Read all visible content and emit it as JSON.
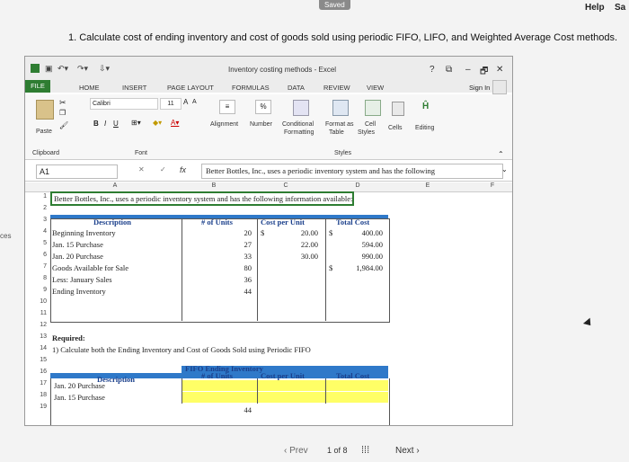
{
  "topbar": {
    "saved": "Saved",
    "help": "Help",
    "cut_right": "Sa",
    "cut_left": "ces"
  },
  "question": "1. Calculate cost of ending inventory and cost of goods sold using periodic FIFO, LIFO, and Weighted Average Cost methods.",
  "excel": {
    "title": "Inventory costing methods - Excel",
    "window_buttons": [
      "?",
      "⧉",
      "–",
      "🗗",
      "✕"
    ],
    "tabs": [
      "FILE",
      "HOME",
      "INSERT",
      "PAGE LAYOUT",
      "FORMULAS",
      "DATA",
      "REVIEW",
      "VIEW"
    ],
    "sign_in": "Sign In",
    "ribbon": {
      "paste": "Paste",
      "clipboard": "Clipboard",
      "font_name": "Calibri",
      "font_size": "11",
      "font_group": "Font",
      "bold": "B",
      "italic": "I",
      "underline": "U",
      "grow": "A",
      "shrink": "A",
      "alignment": "Alignment",
      "number": "Number",
      "percent": "%",
      "conditional": "Conditional",
      "formatting": "Formatting",
      "format_as": "Format as",
      "table": "Table",
      "cell": "Cell",
      "styles_btn": "Styles",
      "styles_group": "Styles",
      "cells": "Cells",
      "editing": "Editing"
    },
    "formula_bar": {
      "name_box": "A1",
      "fx": "fx",
      "text": "Better Bottles, Inc., uses a periodic inventory system and has the following"
    },
    "columns": [
      "A",
      "B",
      "C",
      "D",
      "E",
      "F"
    ],
    "rows": [
      "1",
      "2",
      "3",
      "4",
      "5",
      "6",
      "7",
      "8",
      "9",
      "10",
      "11",
      "12",
      "13",
      "14",
      "15",
      "16",
      "17",
      "18",
      "19"
    ],
    "a1": "Better Bottles, Inc., uses a periodic inventory system and has the following information available:",
    "table1": {
      "headers": [
        "Description",
        "# of Units",
        "Cost per Unit",
        "Total Cost"
      ],
      "rows": [
        {
          "desc": "Beginning Inventory",
          "units": "20",
          "dollar1": "$",
          "cpu": "20.00",
          "dollar2": "$",
          "total": "400.00"
        },
        {
          "desc": "Jan. 15 Purchase",
          "units": "27",
          "dollar1": "",
          "cpu": "22.00",
          "dollar2": "",
          "total": "594.00"
        },
        {
          "desc": "Jan. 20 Purchase",
          "units": "33",
          "dollar1": "",
          "cpu": "30.00",
          "dollar2": "",
          "total": "990.00"
        },
        {
          "desc": "Goods Available for Sale",
          "units": "80",
          "dollar1": "",
          "cpu": "",
          "dollar2": "$",
          "total": "1,984.00"
        },
        {
          "desc": "Less: January Sales",
          "units": "36",
          "dollar1": "",
          "cpu": "",
          "dollar2": "",
          "total": ""
        },
        {
          "desc": "Ending Inventory",
          "units": "44",
          "dollar1": "",
          "cpu": "",
          "dollar2": "",
          "total": ""
        }
      ]
    },
    "required": "Required:",
    "req1": "1) Calculate both the Ending Inventory and Cost of Goods Sold using Periodic FIFO",
    "table2": {
      "title": "FIFO Ending Inventory",
      "headers": [
        "Description",
        "# of Units",
        "Cost per Unit",
        "Total Cost"
      ],
      "rows": [
        "Jan. 20 Purchase",
        "Jan. 15 Purchase"
      ],
      "total_units": "44"
    }
  },
  "nav": {
    "prev": "Prev",
    "page": "1",
    "of": "of 8",
    "next": "Next"
  }
}
